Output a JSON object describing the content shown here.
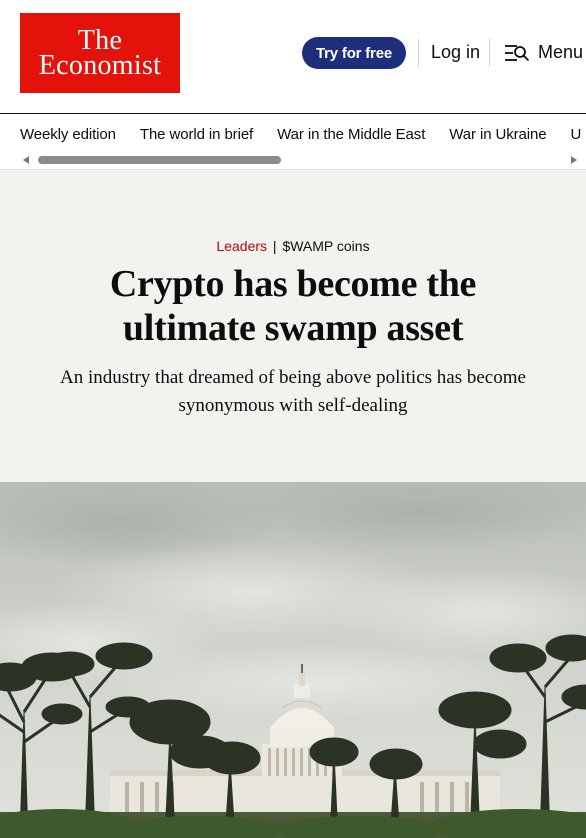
{
  "brand": {
    "line1": "The",
    "line2": "Economist",
    "color": "#e3120b"
  },
  "header": {
    "try_label": "Try for free",
    "login_label": "Log in",
    "menu_label": "Menu",
    "menu_icon": "menu-search-icon"
  },
  "nav": {
    "items": [
      {
        "label": "Weekly edition"
      },
      {
        "label": "The world in brief"
      },
      {
        "label": "War in the Middle East"
      },
      {
        "label": "War in Ukraine"
      },
      {
        "label": "U"
      }
    ]
  },
  "article": {
    "section": "Leaders",
    "separator": "|",
    "flytitle": "$WAMP coins",
    "headline": "Crypto has become the ultimate swamp asset",
    "subhead": "An industry that dreamed of being above politics has become synonymous with self-dealing"
  },
  "colors": {
    "hero_bg": "#f3f2ef",
    "section_red": "#b6090b",
    "cta_blue": "#1f2e7a"
  }
}
